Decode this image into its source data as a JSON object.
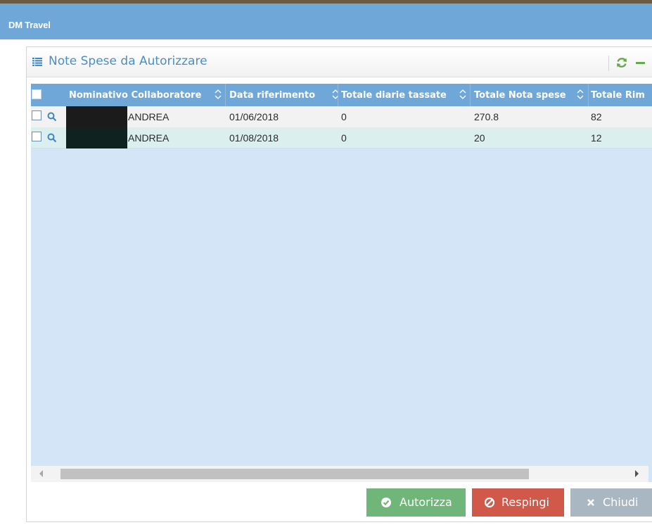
{
  "app": {
    "title": "DM Travel"
  },
  "panel": {
    "title": "Note Spese da Autorizzare",
    "icon": "list-icon",
    "actions": [
      "refresh-icon",
      "minimize-icon"
    ]
  },
  "table": {
    "columns": [
      "Nominativo Collaboratore",
      "Data riferimento",
      "Totale diarie tassate",
      "Totale Nota spese",
      "Totale Rim"
    ],
    "rows": [
      {
        "nominativo": "ANDREA",
        "data": "01/06/2018",
        "diarie": "0",
        "nota": "270.8",
        "rimborso": "82"
      },
      {
        "nominativo": "ANDREA",
        "data": "01/08/2018",
        "diarie": "0",
        "nota": "20",
        "rimborso": "12"
      }
    ]
  },
  "buttons": {
    "autorizza": "Autorizza",
    "respingi": "Respingi",
    "chiudi": "Chiudi"
  },
  "colors": {
    "header_blue": "#6fa8d8",
    "grid_background": "#d4e5f7",
    "title_blue": "#4a8ec6",
    "success": "#71b679",
    "danger": "#d1594a",
    "neutral": "#a9b7c3"
  }
}
